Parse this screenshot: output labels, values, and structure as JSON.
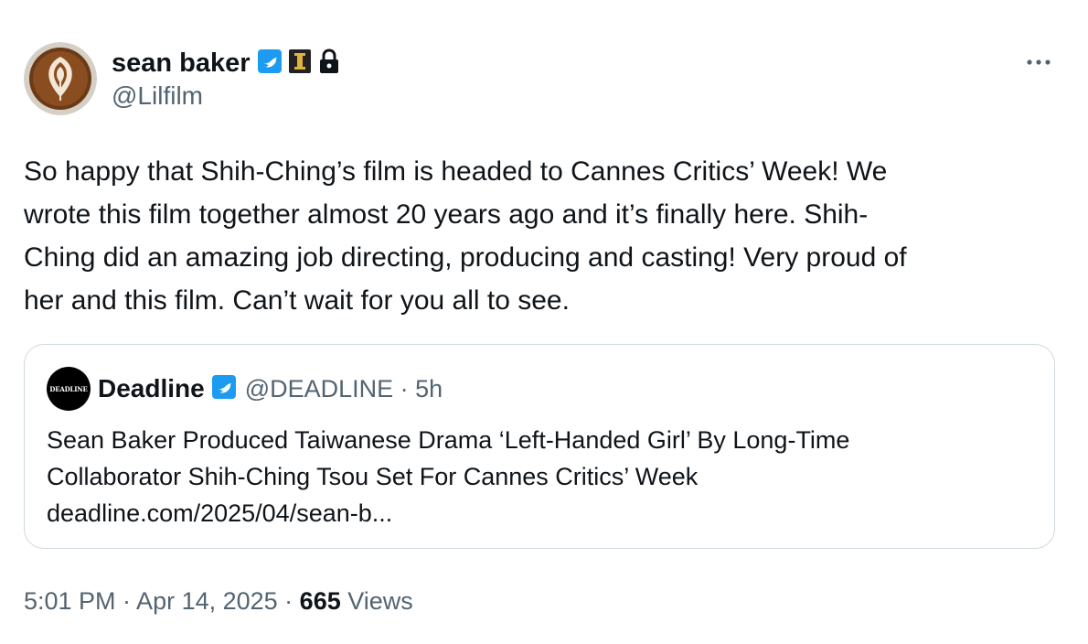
{
  "author": {
    "display_name": "sean baker",
    "handle": "@Lilfilm",
    "avatar_icon": "latte-art-avatar",
    "badges": [
      "verified-badge-icon",
      "affiliate-badge-icon",
      "lock-icon"
    ]
  },
  "tweet": {
    "text": "So happy that Shih-Ching’s film is headed to Cannes Critics’ Week! We\nwrote this film together almost 20 years ago and it’s finally here. Shih-\nChing did an amazing job directing, producing and casting! Very proud of\nher and this film. Can’t wait for you all to see.",
    "more_icon": "more-options-icon"
  },
  "quote": {
    "avatar_text": "DEADLINE",
    "display_name": "Deadline",
    "handle_time": "@DEADLINE · 5h",
    "text": "Sean Baker Produced Taiwanese Drama ‘Left-Handed Girl’ By Long-Time\nCollaborator Shih-Ching Tsou Set For Cannes Critics’ Week\ndeadline.com/2025/04/sean-b..."
  },
  "footer": {
    "timestamp": "5:01 PM · Apr 14, 2025 · ",
    "views_count": "665",
    "views_label": " Views"
  },
  "colors": {
    "primary_text": "#0f1419",
    "secondary_text": "#536471",
    "verified_blue": "#1d9bf0",
    "border": "#cfd9de"
  }
}
